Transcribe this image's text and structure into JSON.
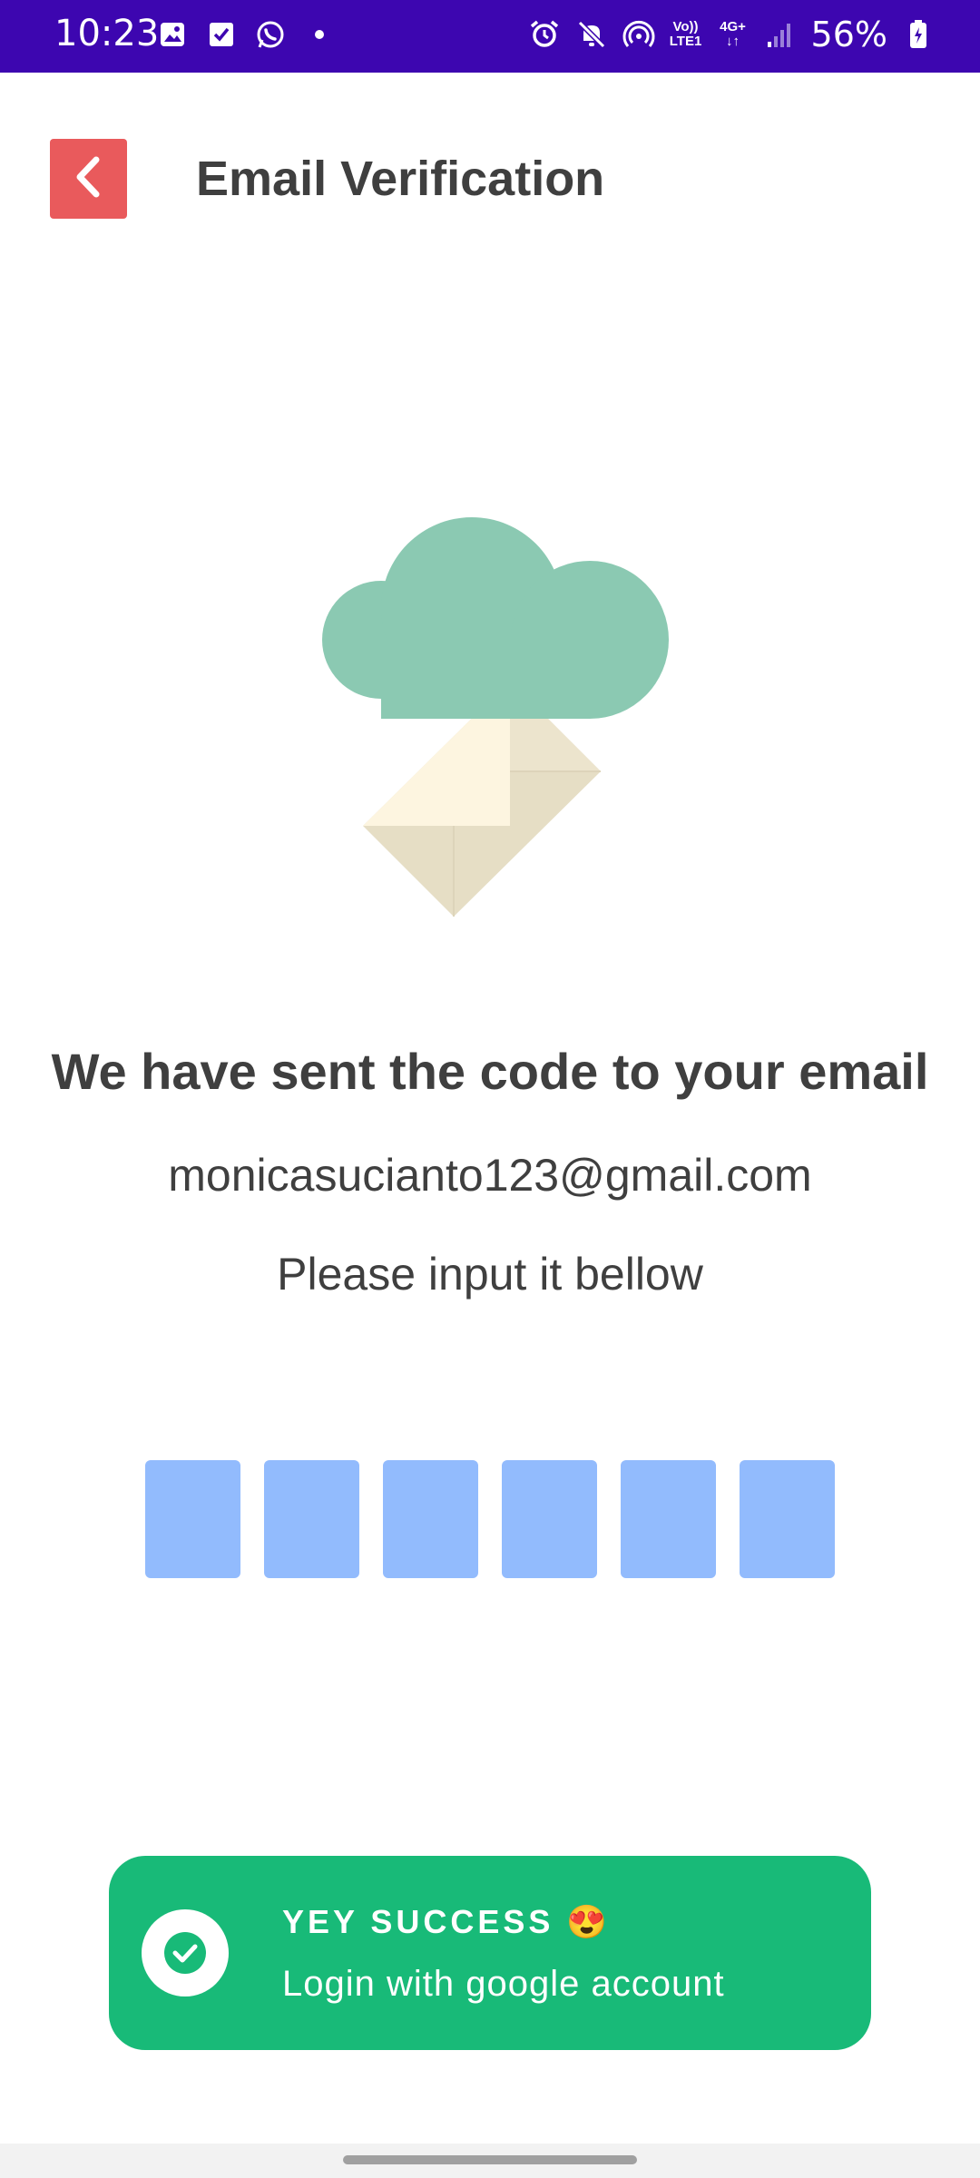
{
  "status_bar": {
    "time": "10:23",
    "battery": "56%",
    "network_top": "Vo))",
    "network_bottom": "LTE1",
    "data_top": "4G+",
    "icons_left": [
      "gallery-icon",
      "checkbox-icon",
      "whatsapp-icon",
      "dot-icon"
    ],
    "icons_right": [
      "alarm-icon",
      "mute-icon",
      "hotspot-icon",
      "volte-icon",
      "4g-icon",
      "signal-icon",
      "battery-icon"
    ]
  },
  "header": {
    "title": "Email Verification",
    "back_icon": "chevron-left-icon"
  },
  "content": {
    "headline": "We have sent the code to your email",
    "email": "monicasucianto123@gmail.com",
    "instruction": "Please input it bellow"
  },
  "otp": {
    "values": [
      "",
      "",
      "",
      "",
      "",
      ""
    ]
  },
  "toast": {
    "title": "YEY SUCCESS 😍",
    "message": "Login with google account",
    "icon": "check-circle-icon"
  },
  "colors": {
    "status_bar": "#3d06b0",
    "back_button": "#e95a5c",
    "otp_box": "#92bbfd",
    "toast": "#18ba78",
    "cloud": "#8bc9b2",
    "envelope_light": "#fdf5e0",
    "envelope_dark": "#e6dec5",
    "text": "#3f3f3f"
  }
}
